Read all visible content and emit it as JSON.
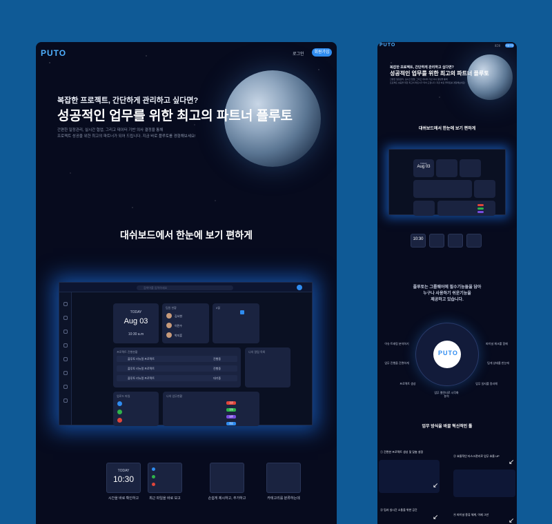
{
  "brand": "PUTO",
  "nav": {
    "login": "로그인",
    "signup": "회원가입"
  },
  "hero": {
    "subtitle": "복잡한 프로젝트, 간단하게 관리하고 싶다면?",
    "title": "성공적인 업무를 위한 최고의 파트너 플루토",
    "desc_line1": "간편한 일정관리, 실시간 협업, 그리고 데이터 기반 의사 결정을 통해",
    "desc_line2": "프로젝트 성공을 위한 최고의 파트너가 되어 드립니다. 지금 바로 플루토를 경험해보세요!"
  },
  "section_dashboard": "대쉬보드에서 한눈에 보기 편하게",
  "dashboard": {
    "search_placeholder": "검색어를 입력하세요",
    "today_label": "TODAY",
    "date": "Aug 03",
    "time": "10:30 a.m",
    "big_time": "10:30",
    "members_title": "팀원 현황",
    "members": [
      "김서현",
      "이민수",
      "박지훈"
    ],
    "calendar_title": "8월",
    "projects_title": "프로젝트 진행현황",
    "project_rows": [
      "플루토 리뉴얼 프로젝트",
      "플루토 리뉴얼 프로젝트",
      "플루토 리뉴얼 프로젝트"
    ],
    "project_status": [
      "진행중",
      "진행중",
      "대기중"
    ],
    "notice_title": "나의 알림 목록",
    "files_title": "업로드 파일",
    "tasks_title": "나의 업무현황",
    "task_tags": [
      "긴급",
      "진행",
      "보류",
      "완료"
    ],
    "tag_colors": [
      "#e0453a",
      "#2fb34a",
      "#7a4de0",
      "#2f8cf0"
    ]
  },
  "features": [
    "시간을 바로 확인하고",
    "최근 파일을 바로 보고",
    "손쉽게 제시하고, 추가하고",
    "카테고리를 분류하는데"
  ],
  "mobile": {
    "intro_line1": "플루토는 그룹웨어에 필수기능들을 담아",
    "intro_line2": "누구나 사용하기 쉬운기능을",
    "intro_line3": "제공하고 있습니다.",
    "wheel": [
      "이슈 트래킹 분석하기",
      "파이널 체크를 함께",
      "업무 진행을 간편하게",
      "팀게 상태를 한눈에",
      "프로젝트 생성",
      "업무 일지를 정리해",
      "업무 캘린더로 시각화 분석",
      "작업 공유"
    ],
    "section_innov": "업무 방식을 바꿀 혁신적인 툴",
    "feature1": "① 간편한 프로젝트 생성 및 맞춤 설정",
    "feature2": "② 효율적인 타스크관리로 업무 효율 UP",
    "feature3": "③ 팀과 실시간 소통을 위한 공간",
    "feature4": "④ 파이널 종류 체계, 이제 그만"
  },
  "accent_color": "#2f8cf0"
}
